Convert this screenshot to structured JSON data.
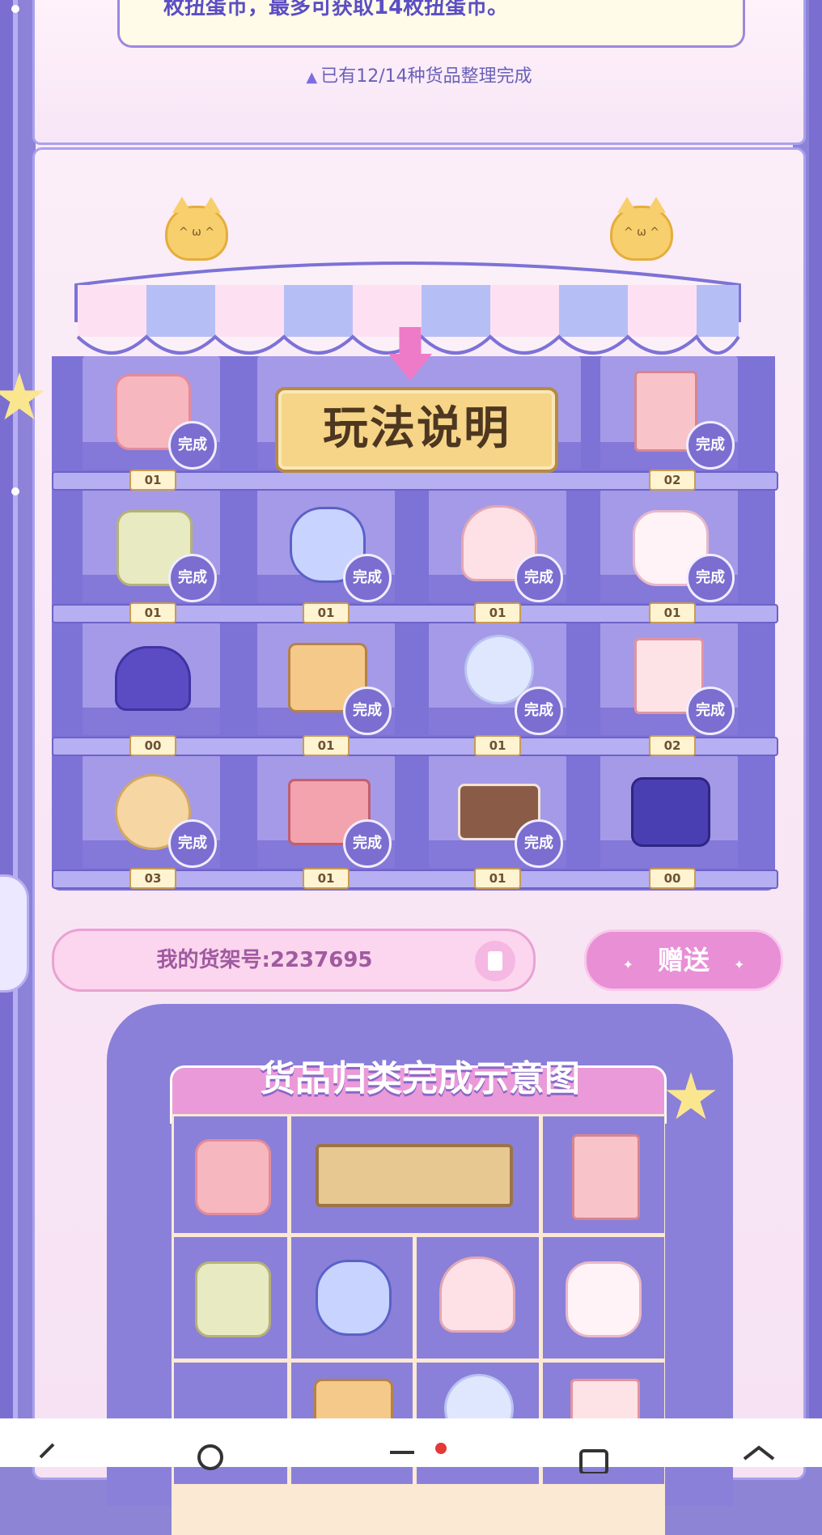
{
  "top": {
    "notice": "枚扭蛋币，最多可获取14枚扭蛋币。",
    "progress": "已有12/14种货品整理完成"
  },
  "shelf": {
    "help_label": "玩法说明",
    "done_label": "完成",
    "slots": [
      {
        "name": "backpack",
        "count": "01",
        "done": true
      },
      {
        "name": "photo-album",
        "count": "02",
        "done": true
      },
      {
        "name": "flower-basket",
        "count": "01",
        "done": true
      },
      {
        "name": "perfume-bottle",
        "count": "01",
        "done": true
      },
      {
        "name": "shell-box",
        "count": "01",
        "done": true
      },
      {
        "name": "bunny-mug",
        "count": "01",
        "done": true
      },
      {
        "name": "cat-ear-hat",
        "count": "00",
        "done": false
      },
      {
        "name": "suitcase",
        "count": "01",
        "done": true
      },
      {
        "name": "crystal-ball",
        "count": "01",
        "done": true
      },
      {
        "name": "milk-carton",
        "count": "02",
        "done": true
      },
      {
        "name": "moon-pillow",
        "count": "03",
        "done": true
      },
      {
        "name": "eyeshadow-palette",
        "count": "01",
        "done": true
      },
      {
        "name": "cake-slice",
        "count": "01",
        "done": true
      },
      {
        "name": "camera",
        "count": "00",
        "done": false
      }
    ]
  },
  "controls": {
    "shelf_number": "我的货架号:2237695",
    "gift_label": "赠送",
    "sparkle": "✦"
  },
  "diagram": {
    "title": "货品归类完成示意图"
  },
  "colors": {
    "accent_purple": "#7d72d6",
    "pink": "#e98fd6",
    "gold": "#f6d588"
  }
}
